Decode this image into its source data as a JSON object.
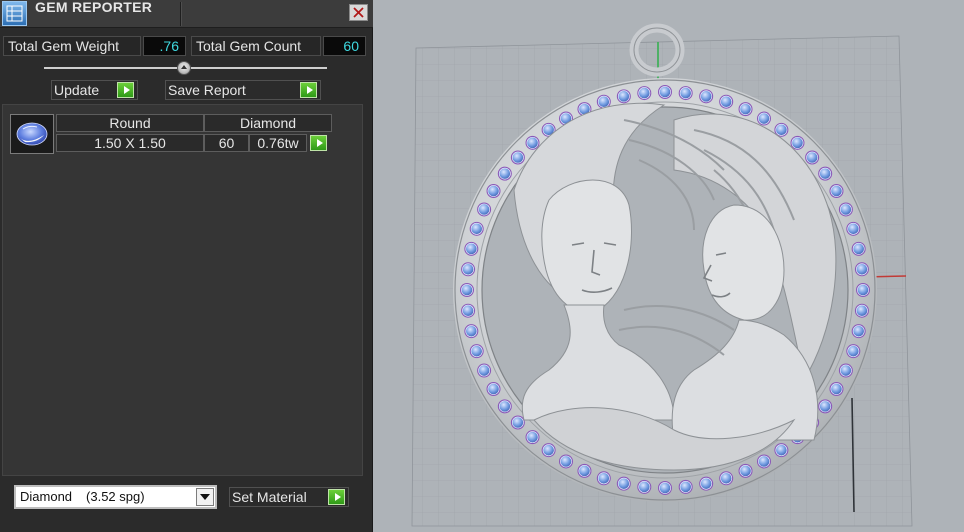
{
  "window": {
    "title": "GEM REPORTER",
    "icon": "gem-reporter-app-icon",
    "close_icon": "close-icon"
  },
  "stats": {
    "total_weight_label": "Total Gem Weight",
    "total_weight_value": ".76",
    "total_count_label": "Total Gem Count",
    "total_count_value": "60"
  },
  "slider": {
    "position": 0.5
  },
  "actions": {
    "update_label": "Update",
    "save_report_label": "Save Report"
  },
  "gem_list": [
    {
      "shape": "Round",
      "material": "Diamond",
      "size": "1.50 X 1.50",
      "count": "60",
      "weight": "0.76tw",
      "icon": "round-gem-icon"
    }
  ],
  "material": {
    "selected_name": "Diamond",
    "selected_spg": "(3.52 spg)",
    "set_label": "Set Material"
  },
  "colors": {
    "panel_bg": "#2b2b2b",
    "value_text": "#3fd9e0",
    "play_green": "#3aa820",
    "viewport_bg": "#aeb3b8",
    "gem_blue": "#6f9ae0",
    "gem_purple": "#8a5ab8",
    "metal": "#d7d9db",
    "axis_red": "#c23a36",
    "axis_green": "#2fb04b"
  },
  "viewport": {
    "model": "3d-pendant-model-with-two-faces",
    "stone_count": 60
  }
}
